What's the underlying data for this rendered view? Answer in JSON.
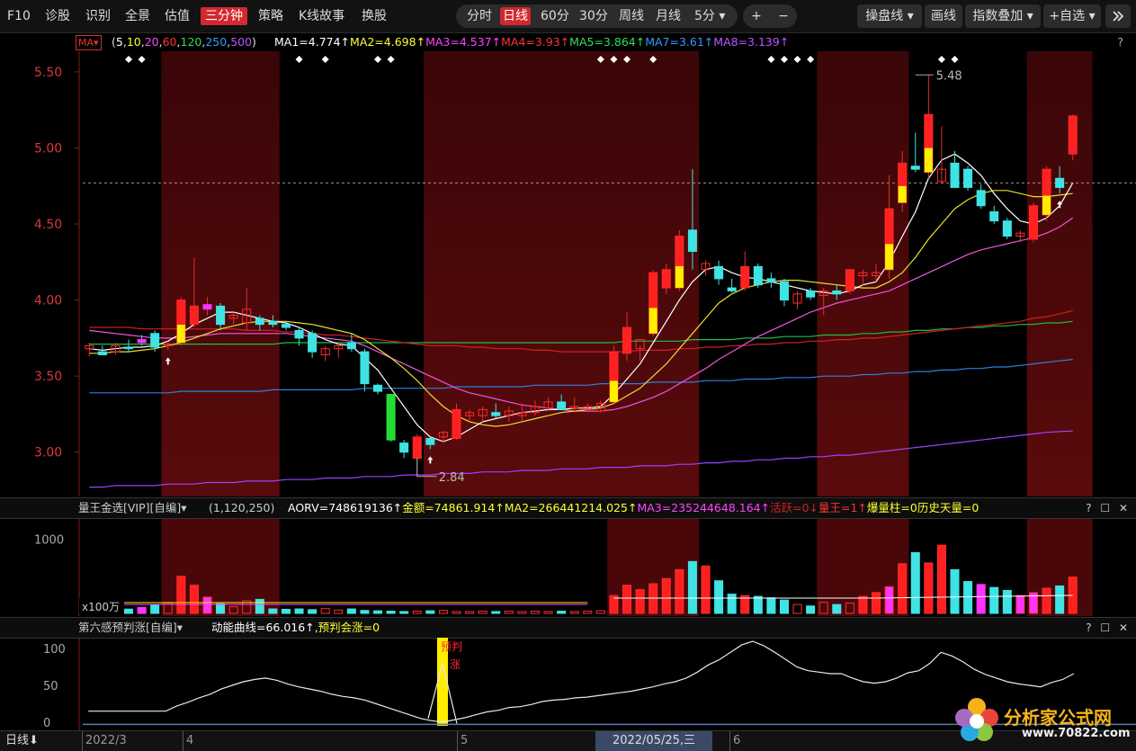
{
  "toolbar": {
    "left_items": [
      "F10",
      "诊股",
      "识别",
      "全景",
      "估值",
      "三分钟",
      "策略",
      "K线故事",
      "换股"
    ],
    "active_item": "三分钟",
    "periods": [
      "分时",
      "日线",
      "60分",
      "30分",
      "周线",
      "月线",
      "5分"
    ],
    "active_period": "日线",
    "plus": "+",
    "minus": "−",
    "dropdown_caret": "▾",
    "right_items": [
      "操盘线",
      "画线",
      "指数叠加",
      "+自选"
    ],
    "close_icon": "collapse-icon"
  },
  "ma_row": {
    "selector": "MA",
    "params": "(5,10,20,60,120,250,500)",
    "params_parts": [
      {
        "t": "(",
        "c": "#dddddd"
      },
      {
        "t": "5",
        "c": "#ffffff"
      },
      {
        "t": ",",
        "c": "#dddddd"
      },
      {
        "t": "10",
        "c": "#ffff33"
      },
      {
        "t": ",",
        "c": "#dddddd"
      },
      {
        "t": "20",
        "c": "#ff44ff"
      },
      {
        "t": ",",
        "c": "#dddddd"
      },
      {
        "t": "60",
        "c": "#ff3333"
      },
      {
        "t": ",",
        "c": "#dddddd"
      },
      {
        "t": "120",
        "c": "#33dd55"
      },
      {
        "t": ",",
        "c": "#dddddd"
      },
      {
        "t": "250",
        "c": "#3399ff"
      },
      {
        "t": ",",
        "c": "#dddddd"
      },
      {
        "t": "500",
        "c": "#bb55ff"
      },
      {
        "t": ")",
        "c": "#dddddd"
      }
    ],
    "values": [
      {
        "label": "MA1=4.774↑",
        "color": "#ffffff"
      },
      {
        "label": "MA2=4.698↑",
        "color": "#ffff33"
      },
      {
        "label": "MA3=4.537↑",
        "color": "#ff44ff"
      },
      {
        "label": "MA4=3.93↑",
        "color": "#ff3333"
      },
      {
        "label": "MA5=3.864↑",
        "color": "#33dd55"
      },
      {
        "label": "MA7=3.61↑",
        "color": "#3399ff"
      },
      {
        "label": "MA8=3.139↑",
        "color": "#bb55ff"
      }
    ],
    "help": "?"
  },
  "price_axis": [
    "5.50",
    "5.00",
    "4.50",
    "4.00",
    "3.50",
    "3.00"
  ],
  "price_annotations": {
    "high": "5.48",
    "low": "2.84"
  },
  "volume_pane": {
    "title": "量王金选[VIP][自编]",
    "params": "(1,120,250)",
    "values": [
      {
        "label": "AORV=748619136↑",
        "color": "#ffffff"
      },
      {
        "label": "金额=74861.914↑",
        "color": "#ffff33"
      },
      {
        "label": "MA2=266441214.025↑",
        "color": "#ffff33"
      },
      {
        "label": "MA3=235244648.164↑",
        "color": "#ff44ff"
      },
      {
        "label": "活跃=0↓",
        "color": "#cc2222"
      },
      {
        "label": "量王=1↑",
        "color": "#ff3333"
      },
      {
        "label": "爆量柱=0",
        "color": "#ffff33"
      },
      {
        "label": "历史天量=0",
        "color": "#ffff33"
      }
    ],
    "axis": [
      "1000"
    ],
    "unit": "x100万",
    "icons": "? ☐ ✕"
  },
  "sixth_pane": {
    "title": "第六感预判涨[自编]",
    "values": [
      {
        "label": "动能曲线=66.016↑",
        "color": "#ffffff"
      },
      {
        "label": ",预判会涨=0",
        "color": "#ffff33"
      }
    ],
    "axis": [
      "100",
      "50",
      "0"
    ],
    "signal_label_1": "预判",
    "signal_label_2": "涨",
    "icons": "? ☐ ✕"
  },
  "bottom_bar": {
    "period": "日线",
    "dates": [
      "2022/3",
      "4",
      "5",
      "2022/05/25,三",
      "6"
    ]
  },
  "watermark": {
    "text": "分析家公式网",
    "url": "www.70822.com"
  },
  "colors": {
    "up": "#ff2020",
    "down": "#33e0e0",
    "accent": "#d2282e",
    "bg": "#000000"
  },
  "chart_data": {
    "type": "candlestick",
    "ylim": [
      2.75,
      5.6
    ],
    "candles": [
      {
        "o": 3.68,
        "h": 3.72,
        "l": 3.63,
        "c": 3.7
      },
      {
        "o": 3.66,
        "h": 3.7,
        "l": 3.64,
        "c": 3.64
      },
      {
        "o": 3.66,
        "h": 3.72,
        "l": 3.64,
        "c": 3.7
      },
      {
        "o": 3.69,
        "h": 3.74,
        "l": 3.66,
        "c": 3.68
      },
      {
        "o": 3.74,
        "h": 3.77,
        "l": 3.7,
        "c": 3.72
      },
      {
        "o": 3.78,
        "h": 3.8,
        "l": 3.66,
        "c": 3.69
      },
      {
        "o": 3.7,
        "h": 3.72,
        "l": 3.67,
        "c": 3.71
      },
      {
        "o": 3.72,
        "h": 4.02,
        "l": 3.7,
        "c": 4.0
      },
      {
        "o": 3.84,
        "h": 4.28,
        "l": 3.82,
        "c": 3.96
      },
      {
        "o": 3.94,
        "h": 4.02,
        "l": 3.9,
        "c": 3.97
      },
      {
        "o": 3.96,
        "h": 3.98,
        "l": 3.8,
        "c": 3.84
      },
      {
        "o": 3.88,
        "h": 3.92,
        "l": 3.84,
        "c": 3.9
      },
      {
        "o": 3.85,
        "h": 4.08,
        "l": 3.8,
        "c": 3.94
      },
      {
        "o": 3.88,
        "h": 3.9,
        "l": 3.8,
        "c": 3.84
      },
      {
        "o": 3.86,
        "h": 3.9,
        "l": 3.82,
        "c": 3.84
      },
      {
        "o": 3.84,
        "h": 3.86,
        "l": 3.8,
        "c": 3.82
      },
      {
        "o": 3.8,
        "h": 3.82,
        "l": 3.7,
        "c": 3.75
      },
      {
        "o": 3.78,
        "h": 3.8,
        "l": 3.62,
        "c": 3.66
      },
      {
        "o": 3.64,
        "h": 3.7,
        "l": 3.6,
        "c": 3.68
      },
      {
        "o": 3.68,
        "h": 3.72,
        "l": 3.62,
        "c": 3.7
      },
      {
        "o": 3.72,
        "h": 3.78,
        "l": 3.66,
        "c": 3.68
      },
      {
        "o": 3.66,
        "h": 3.68,
        "l": 3.4,
        "c": 3.45
      },
      {
        "o": 3.44,
        "h": 3.45,
        "l": 3.38,
        "c": 3.4
      },
      {
        "o": 3.38,
        "h": 3.38,
        "l": 3.07,
        "c": 3.08
      },
      {
        "o": 3.06,
        "h": 3.08,
        "l": 2.96,
        "c": 3.0
      },
      {
        "o": 2.96,
        "h": 3.12,
        "l": 2.84,
        "c": 3.1
      },
      {
        "o": 3.09,
        "h": 3.1,
        "l": 3.02,
        "c": 3.05
      },
      {
        "o": 3.1,
        "h": 3.14,
        "l": 3.06,
        "c": 3.13
      },
      {
        "o": 3.09,
        "h": 3.32,
        "l": 3.08,
        "c": 3.28
      },
      {
        "o": 3.24,
        "h": 3.28,
        "l": 3.2,
        "c": 3.26
      },
      {
        "o": 3.24,
        "h": 3.3,
        "l": 3.2,
        "c": 3.28
      },
      {
        "o": 3.26,
        "h": 3.32,
        "l": 3.22,
        "c": 3.24
      },
      {
        "o": 3.24,
        "h": 3.3,
        "l": 3.2,
        "c": 3.27
      },
      {
        "o": 3.24,
        "h": 3.32,
        "l": 3.2,
        "c": 3.26
      },
      {
        "o": 3.26,
        "h": 3.34,
        "l": 3.24,
        "c": 3.3
      },
      {
        "o": 3.29,
        "h": 3.36,
        "l": 3.27,
        "c": 3.33
      },
      {
        "o": 3.33,
        "h": 3.38,
        "l": 3.28,
        "c": 3.28
      },
      {
        "o": 3.3,
        "h": 3.36,
        "l": 3.26,
        "c": 3.3
      },
      {
        "o": 3.28,
        "h": 3.32,
        "l": 3.26,
        "c": 3.3
      },
      {
        "o": 3.27,
        "h": 3.34,
        "l": 3.26,
        "c": 3.32
      },
      {
        "o": 3.33,
        "h": 3.7,
        "l": 3.32,
        "c": 3.66
      },
      {
        "o": 3.65,
        "h": 3.92,
        "l": 3.6,
        "c": 3.82
      },
      {
        "o": 3.68,
        "h": 3.7,
        "l": 3.6,
        "c": 3.74
      },
      {
        "o": 3.78,
        "h": 4.2,
        "l": 3.76,
        "c": 4.18
      },
      {
        "o": 4.08,
        "h": 4.24,
        "l": 4.04,
        "c": 4.2
      },
      {
        "o": 4.08,
        "h": 4.46,
        "l": 4.06,
        "c": 4.42
      },
      {
        "o": 4.46,
        "h": 4.86,
        "l": 4.2,
        "c": 4.32
      },
      {
        "o": 4.2,
        "h": 4.26,
        "l": 4.16,
        "c": 4.24
      },
      {
        "o": 4.22,
        "h": 4.26,
        "l": 4.1,
        "c": 4.14
      },
      {
        "o": 4.08,
        "h": 4.14,
        "l": 4.05,
        "c": 4.06
      },
      {
        "o": 4.08,
        "h": 4.32,
        "l": 4.06,
        "c": 4.22
      },
      {
        "o": 4.22,
        "h": 4.24,
        "l": 4.08,
        "c": 4.1
      },
      {
        "o": 4.14,
        "h": 4.18,
        "l": 4.08,
        "c": 4.12
      },
      {
        "o": 4.12,
        "h": 4.14,
        "l": 3.96,
        "c": 4.0
      },
      {
        "o": 3.98,
        "h": 4.06,
        "l": 3.94,
        "c": 4.04
      },
      {
        "o": 4.06,
        "h": 4.08,
        "l": 4.0,
        "c": 4.02
      },
      {
        "o": 4.03,
        "h": 4.08,
        "l": 3.9,
        "c": 4.06
      },
      {
        "o": 4.06,
        "h": 4.1,
        "l": 4.0,
        "c": 4.04
      },
      {
        "o": 4.06,
        "h": 4.2,
        "l": 4.04,
        "c": 4.2
      },
      {
        "o": 4.16,
        "h": 4.2,
        "l": 4.1,
        "c": 4.18
      },
      {
        "o": 4.16,
        "h": 4.24,
        "l": 4.12,
        "c": 4.18
      },
      {
        "o": 4.2,
        "h": 4.82,
        "l": 4.14,
        "c": 4.6
      },
      {
        "o": 4.64,
        "h": 4.98,
        "l": 4.58,
        "c": 4.9
      },
      {
        "o": 4.88,
        "h": 5.1,
        "l": 4.84,
        "c": 4.86
      },
      {
        "o": 4.84,
        "h": 5.48,
        "l": 4.8,
        "c": 5.22
      },
      {
        "o": 4.78,
        "h": 5.14,
        "l": 4.76,
        "c": 4.86
      },
      {
        "o": 4.9,
        "h": 4.98,
        "l": 4.74,
        "c": 4.74
      },
      {
        "o": 4.86,
        "h": 4.88,
        "l": 4.72,
        "c": 4.74
      },
      {
        "o": 4.72,
        "h": 4.76,
        "l": 4.6,
        "c": 4.62
      },
      {
        "o": 4.58,
        "h": 4.62,
        "l": 4.5,
        "c": 4.52
      },
      {
        "o": 4.52,
        "h": 4.54,
        "l": 4.4,
        "c": 4.42
      },
      {
        "o": 4.42,
        "h": 4.46,
        "l": 4.38,
        "c": 4.44
      },
      {
        "o": 4.4,
        "h": 4.64,
        "l": 4.38,
        "c": 4.62
      },
      {
        "o": 4.56,
        "h": 4.88,
        "l": 4.52,
        "c": 4.86
      },
      {
        "o": 4.8,
        "h": 4.88,
        "l": 4.7,
        "c": 4.74
      },
      {
        "o": 4.96,
        "h": 5.22,
        "l": 4.92,
        "c": 5.21
      }
    ],
    "ma5": [
      3.68,
      3.67,
      3.68,
      3.69,
      3.69,
      3.7,
      3.73,
      3.78,
      3.84,
      3.88,
      3.92,
      3.92,
      3.9,
      3.88,
      3.86,
      3.85,
      3.82,
      3.78,
      3.74,
      3.71,
      3.7,
      3.62,
      3.54,
      3.42,
      3.3,
      3.18,
      3.1,
      3.07,
      3.1,
      3.15,
      3.2,
      3.22,
      3.24,
      3.26,
      3.27,
      3.28,
      3.28,
      3.29,
      3.29,
      3.3,
      3.38,
      3.48,
      3.58,
      3.72,
      3.86,
      4.0,
      4.12,
      4.2,
      4.22,
      4.18,
      4.15,
      4.14,
      4.12,
      4.1,
      4.08,
      4.06,
      4.05,
      4.04,
      4.06,
      4.1,
      4.12,
      4.25,
      4.42,
      4.58,
      4.8,
      4.92,
      4.96,
      4.9,
      4.82,
      4.7,
      4.6,
      4.52,
      4.5,
      4.54,
      4.62,
      4.77
    ],
    "ma10": [
      3.65,
      3.65,
      3.66,
      3.66,
      3.67,
      3.68,
      3.7,
      3.72,
      3.75,
      3.78,
      3.81,
      3.83,
      3.85,
      3.86,
      3.86,
      3.86,
      3.85,
      3.84,
      3.82,
      3.8,
      3.78,
      3.74,
      3.68,
      3.62,
      3.55,
      3.47,
      3.38,
      3.3,
      3.24,
      3.2,
      3.18,
      3.17,
      3.18,
      3.2,
      3.22,
      3.24,
      3.26,
      3.27,
      3.28,
      3.29,
      3.32,
      3.37,
      3.42,
      3.5,
      3.58,
      3.68,
      3.78,
      3.88,
      3.98,
      4.04,
      4.08,
      4.1,
      4.12,
      4.13,
      4.13,
      4.12,
      4.11,
      4.1,
      4.09,
      4.08,
      4.08,
      4.12,
      4.18,
      4.28,
      4.4,
      4.5,
      4.6,
      4.66,
      4.7,
      4.72,
      4.72,
      4.7,
      4.68,
      4.68,
      4.69,
      4.7
    ],
    "ma20": [
      3.8,
      3.79,
      3.78,
      3.77,
      3.76,
      3.75,
      3.75,
      3.75,
      3.76,
      3.77,
      3.78,
      3.78,
      3.78,
      3.78,
      3.78,
      3.78,
      3.77,
      3.76,
      3.75,
      3.74,
      3.73,
      3.7,
      3.66,
      3.62,
      3.58,
      3.54,
      3.5,
      3.46,
      3.42,
      3.39,
      3.37,
      3.35,
      3.33,
      3.31,
      3.3,
      3.29,
      3.28,
      3.27,
      3.27,
      3.27,
      3.28,
      3.3,
      3.33,
      3.36,
      3.4,
      3.45,
      3.5,
      3.55,
      3.61,
      3.66,
      3.71,
      3.76,
      3.8,
      3.84,
      3.88,
      3.92,
      3.95,
      3.98,
      4.0,
      4.02,
      4.04,
      4.06,
      4.1,
      4.14,
      4.18,
      4.22,
      4.26,
      4.3,
      4.33,
      4.35,
      4.37,
      4.39,
      4.41,
      4.44,
      4.48,
      4.54
    ],
    "ma60": [
      3.82,
      3.82,
      3.82,
      3.82,
      3.81,
      3.81,
      3.81,
      3.81,
      3.81,
      3.81,
      3.81,
      3.81,
      3.8,
      3.8,
      3.8,
      3.79,
      3.79,
      3.78,
      3.77,
      3.77,
      3.76,
      3.75,
      3.74,
      3.73,
      3.72,
      3.71,
      3.7,
      3.7,
      3.7,
      3.69,
      3.69,
      3.68,
      3.68,
      3.68,
      3.67,
      3.67,
      3.66,
      3.66,
      3.66,
      3.66,
      3.66,
      3.66,
      3.67,
      3.67,
      3.67,
      3.68,
      3.68,
      3.69,
      3.69,
      3.7,
      3.7,
      3.71,
      3.71,
      3.72,
      3.72,
      3.73,
      3.73,
      3.74,
      3.74,
      3.75,
      3.75,
      3.76,
      3.77,
      3.78,
      3.79,
      3.8,
      3.81,
      3.82,
      3.83,
      3.84,
      3.85,
      3.86,
      3.88,
      3.89,
      3.91,
      3.93
    ],
    "ma120": [
      3.71,
      3.71,
      3.71,
      3.71,
      3.71,
      3.71,
      3.71,
      3.71,
      3.71,
      3.71,
      3.71,
      3.71,
      3.71,
      3.71,
      3.71,
      3.72,
      3.72,
      3.72,
      3.72,
      3.72,
      3.72,
      3.72,
      3.72,
      3.72,
      3.72,
      3.72,
      3.72,
      3.72,
      3.72,
      3.72,
      3.72,
      3.72,
      3.72,
      3.72,
      3.72,
      3.72,
      3.72,
      3.72,
      3.72,
      3.72,
      3.72,
      3.73,
      3.73,
      3.73,
      3.73,
      3.73,
      3.74,
      3.74,
      3.74,
      3.74,
      3.75,
      3.75,
      3.75,
      3.76,
      3.76,
      3.76,
      3.77,
      3.77,
      3.77,
      3.78,
      3.78,
      3.79,
      3.79,
      3.8,
      3.8,
      3.81,
      3.81,
      3.82,
      3.82,
      3.83,
      3.83,
      3.84,
      3.84,
      3.85,
      3.85,
      3.86
    ],
    "ma250": [
      3.39,
      3.39,
      3.39,
      3.39,
      3.39,
      3.39,
      3.39,
      3.4,
      3.4,
      3.4,
      3.4,
      3.4,
      3.4,
      3.4,
      3.41,
      3.41,
      3.41,
      3.41,
      3.41,
      3.41,
      3.41,
      3.42,
      3.42,
      3.42,
      3.42,
      3.42,
      3.42,
      3.42,
      3.43,
      3.43,
      3.43,
      3.43,
      3.43,
      3.43,
      3.44,
      3.44,
      3.44,
      3.44,
      3.44,
      3.45,
      3.45,
      3.45,
      3.45,
      3.46,
      3.46,
      3.46,
      3.46,
      3.47,
      3.47,
      3.47,
      3.48,
      3.48,
      3.48,
      3.49,
      3.49,
      3.49,
      3.5,
      3.5,
      3.5,
      3.51,
      3.51,
      3.52,
      3.52,
      3.53,
      3.53,
      3.54,
      3.54,
      3.55,
      3.55,
      3.56,
      3.56,
      3.57,
      3.58,
      3.59,
      3.6,
      3.61
    ],
    "ma500": [
      2.77,
      2.77,
      2.78,
      2.78,
      2.78,
      2.78,
      2.79,
      2.79,
      2.79,
      2.8,
      2.8,
      2.8,
      2.81,
      2.81,
      2.81,
      2.82,
      2.82,
      2.82,
      2.83,
      2.83,
      2.83,
      2.84,
      2.84,
      2.84,
      2.85,
      2.85,
      2.85,
      2.86,
      2.86,
      2.86,
      2.87,
      2.87,
      2.87,
      2.88,
      2.88,
      2.88,
      2.89,
      2.89,
      2.89,
      2.9,
      2.9,
      2.9,
      2.91,
      2.91,
      2.91,
      2.92,
      2.92,
      2.93,
      2.93,
      2.94,
      2.94,
      2.95,
      2.95,
      2.96,
      2.96,
      2.97,
      2.97,
      2.98,
      2.98,
      2.99,
      3.0,
      3.01,
      3.02,
      3.03,
      3.04,
      3.05,
      3.06,
      3.07,
      3.08,
      3.09,
      3.1,
      3.11,
      3.12,
      3.13,
      3.135,
      3.139
    ],
    "red_zones": [
      [
        6,
        14
      ],
      [
        26,
        46
      ],
      [
        56,
        62
      ],
      [
        72,
        76
      ]
    ],
    "up_arrows": [
      6,
      26,
      74
    ],
    "volume": [
      60,
      55,
      70,
      58,
      80,
      110,
      140,
      500,
      380,
      220,
      130,
      90,
      170,
      190,
      60,
      55,
      60,
      50,
      65,
      45,
      60,
      40,
      35,
      30,
      25,
      30,
      35,
      40,
      25,
      25,
      30,
      25,
      30,
      25,
      30,
      25,
      30,
      25,
      30,
      35,
      240,
      380,
      320,
      400,
      470,
      590,
      700,
      640,
      440,
      260,
      240,
      230,
      210,
      180,
      120,
      100,
      150,
      120,
      140,
      230,
      280,
      360,
      670,
      820,
      680,
      920,
      590,
      430,
      390,
      350,
      310,
      240,
      280,
      340,
      370,
      490
    ],
    "volume_ylim": [
      0,
      1250
    ],
    "momentum": [
      15,
      15,
      15,
      15,
      15,
      15,
      15,
      15,
      22,
      27,
      33,
      38,
      45,
      50,
      55,
      58,
      60,
      57,
      52,
      48,
      45,
      42,
      38,
      35,
      33,
      30,
      25,
      20,
      15,
      10,
      5,
      2,
      0,
      3,
      6,
      10,
      14,
      16,
      20,
      21,
      24,
      28,
      30,
      31,
      33,
      34,
      36,
      38,
      40,
      42,
      45,
      48,
      52,
      55,
      60,
      68,
      78,
      85,
      95,
      105,
      110,
      104,
      95,
      85,
      75,
      70,
      68,
      66,
      66,
      60,
      55,
      53,
      55,
      60,
      67,
      70,
      80,
      95,
      90,
      82,
      72,
      65,
      60,
      55,
      52,
      50,
      48,
      54,
      58,
      66
    ],
    "momentum_ylim": [
      -5,
      110
    ],
    "signal_index": 31
  }
}
